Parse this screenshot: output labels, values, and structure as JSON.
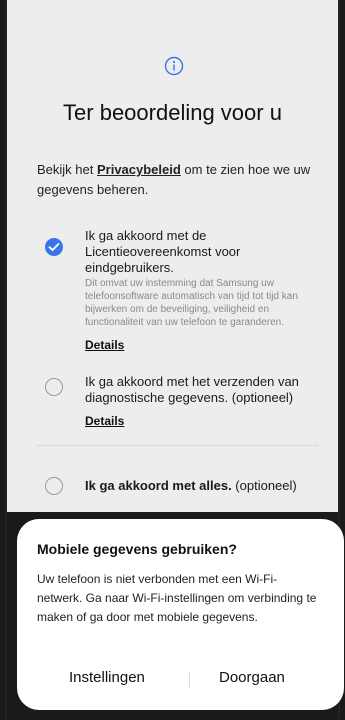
{
  "page": {
    "title": "Ter beoordeling voor u",
    "intro_before": "Bekijk het ",
    "intro_link": "Privacybeleid",
    "intro_after": " om te zien hoe we uw gegevens beheren."
  },
  "options": [
    {
      "label": "Ik ga akkoord met de Licentieovereenkomst voor eindgebruikers.",
      "checked": true,
      "description": "Dit omvat uw instemming dat Samsung uw telefoonsoftware automatisch van tijd tot tijd kan bijwerken om de beveiliging, veiligheid en functionaliteit van uw telefoon te garanderen.",
      "details": "Details"
    },
    {
      "label": "Ik ga akkoord met het verzenden van diagnostische gegevens. (optioneel)",
      "checked": false,
      "details": "Details"
    }
  ],
  "all_option": {
    "label_bold": "Ik ga akkoord met alles.",
    "label_rest": " (optioneel)",
    "checked": false
  },
  "dialog": {
    "title": "Mobiele gegevens gebruiken?",
    "body": "Uw telefoon is niet verbonden met een Wi-Fi-netwerk. Ga naar Wi-Fi-instellingen om verbinding te maken of ga door met mobiele gegevens.",
    "settings_label": "Instellingen",
    "continue_label": "Doorgaan"
  },
  "colors": {
    "accent": "#3a74ea",
    "background": "#ededed"
  },
  "icons": {
    "header": "info-icon",
    "checked": "check-circle-icon",
    "unchecked": "empty-circle-icon"
  }
}
